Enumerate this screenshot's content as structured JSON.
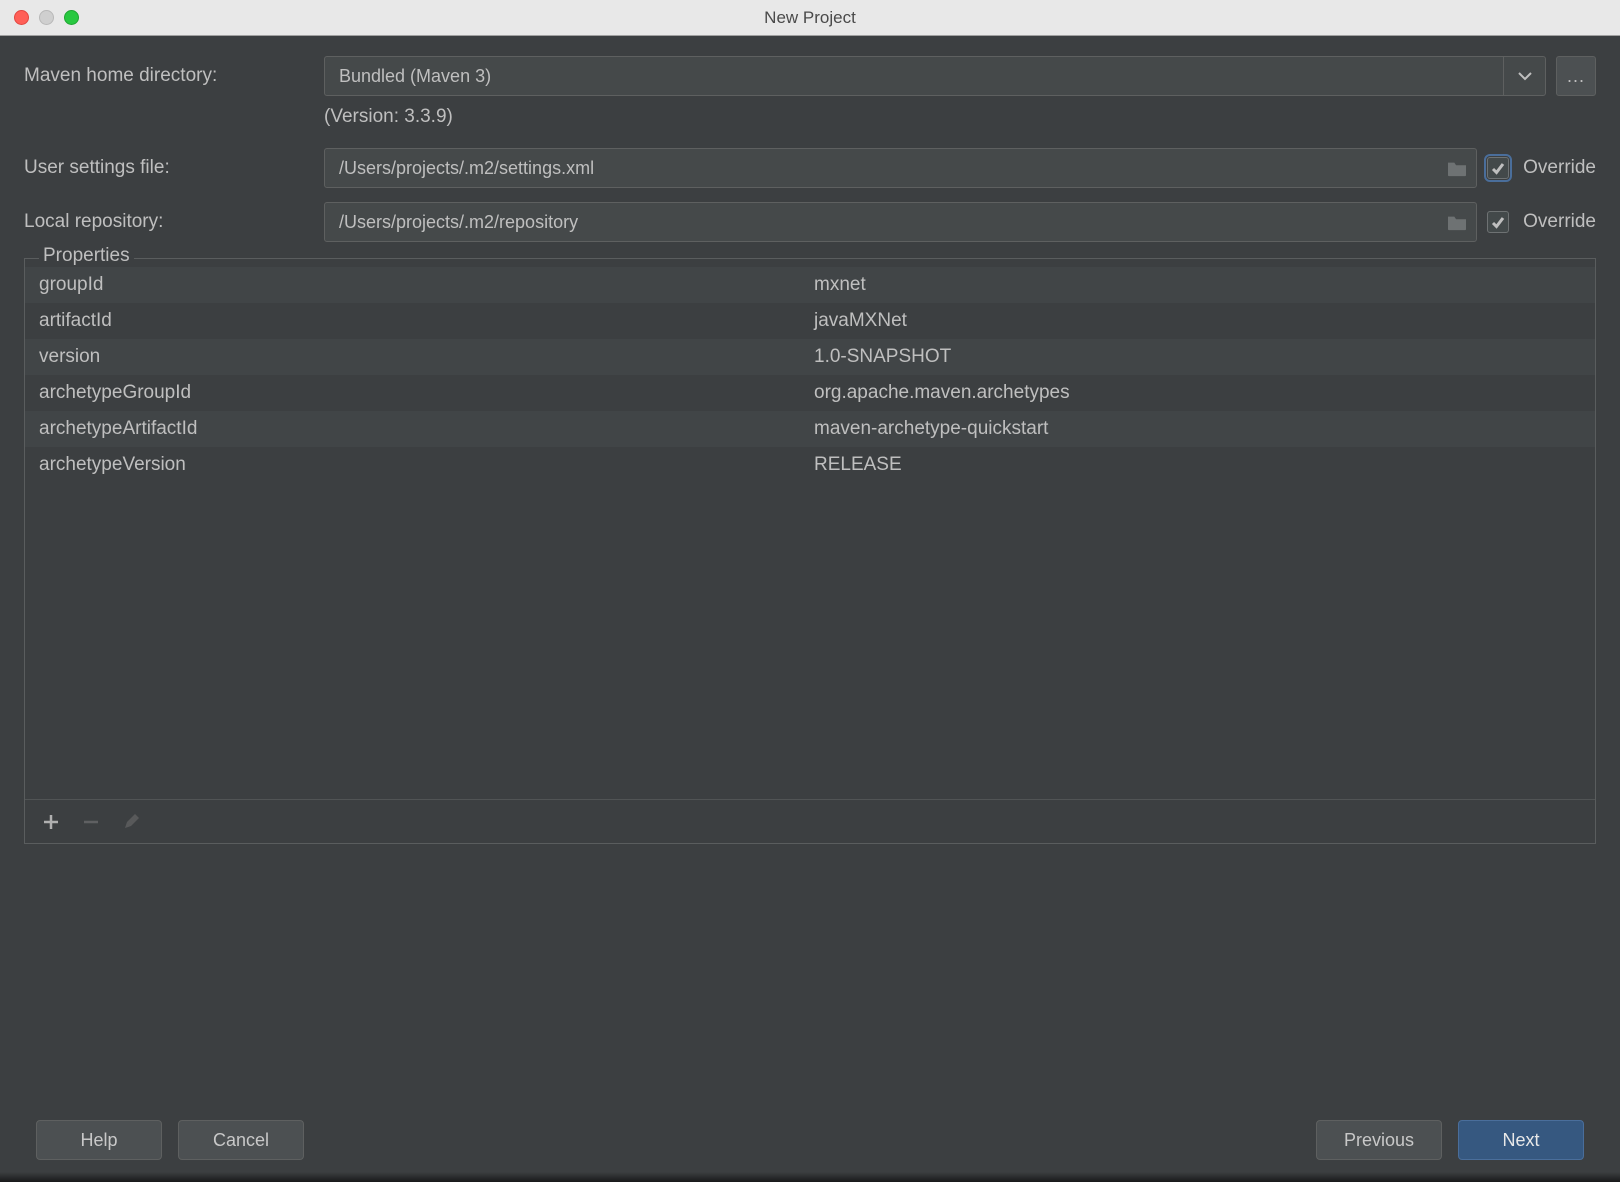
{
  "window": {
    "title": "New Project"
  },
  "maven_home": {
    "label": "Maven home directory:",
    "value": "Bundled (Maven 3)",
    "version_note": "(Version: 3.3.9)",
    "ellipsis": "..."
  },
  "user_settings": {
    "label": "User settings file:",
    "value": "/Users/projects/.m2/settings.xml",
    "override_label": "Override",
    "override_checked": true
  },
  "local_repo": {
    "label": "Local repository:",
    "value": "/Users/projects/.m2/repository",
    "override_label": "Override",
    "override_checked": true
  },
  "properties": {
    "legend": "Properties",
    "rows": [
      {
        "k": "groupId",
        "v": "mxnet"
      },
      {
        "k": "artifactId",
        "v": "javaMXNet"
      },
      {
        "k": "version",
        "v": "1.0-SNAPSHOT"
      },
      {
        "k": "archetypeGroupId",
        "v": "org.apache.maven.archetypes"
      },
      {
        "k": "archetypeArtifactId",
        "v": "maven-archetype-quickstart"
      },
      {
        "k": "archetypeVersion",
        "v": "RELEASE"
      }
    ]
  },
  "footer": {
    "help": "Help",
    "cancel": "Cancel",
    "previous": "Previous",
    "next": "Next"
  }
}
